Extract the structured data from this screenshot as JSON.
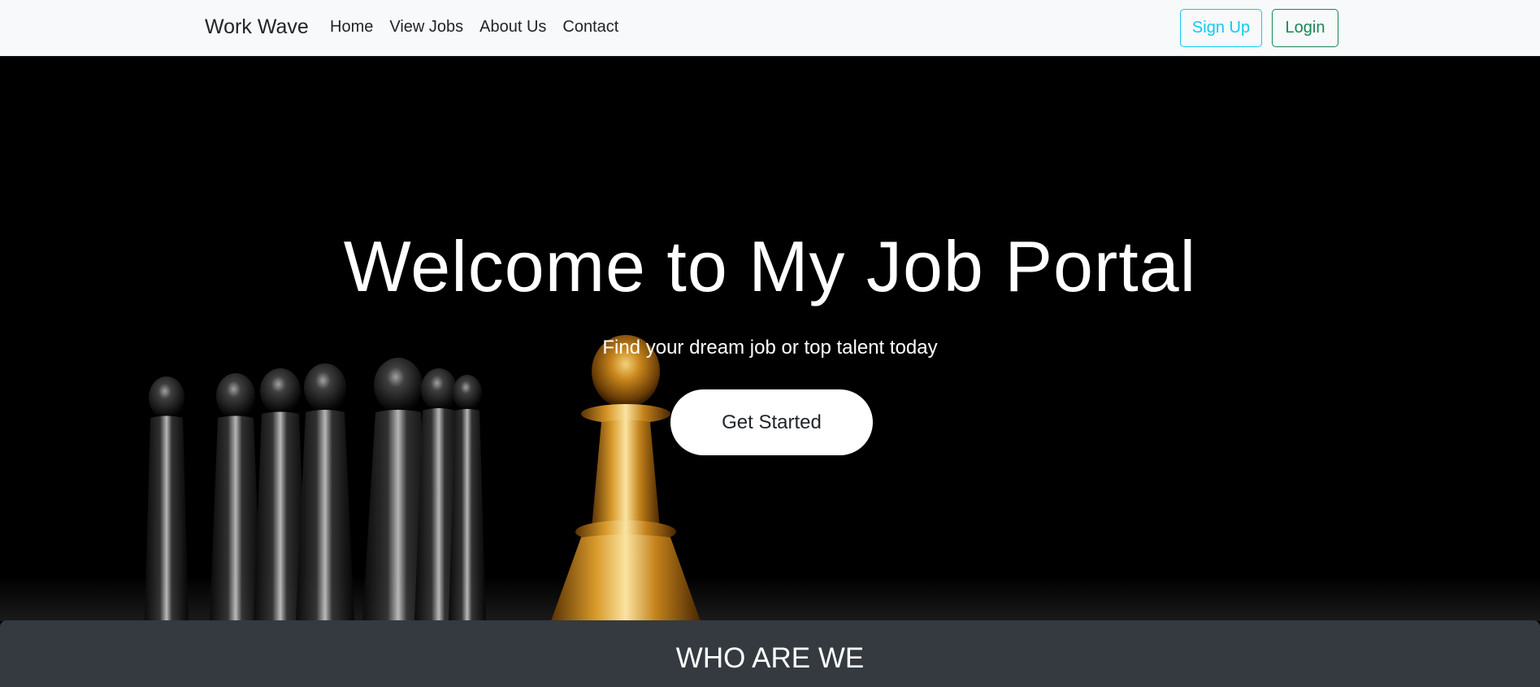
{
  "navbar": {
    "brand": "Work Wave",
    "links": [
      "Home",
      "View Jobs",
      "About Us",
      "Contact"
    ],
    "signup_label": "Sign Up",
    "login_label": "Login"
  },
  "hero": {
    "title": "Welcome to My Job Portal",
    "subtitle": "Find your dream job or top talent today",
    "cta_label": "Get Started",
    "background": "chess-pawns-image"
  },
  "about": {
    "title": "WHO ARE WE"
  },
  "colors": {
    "navbar_bg": "#f8f9fa",
    "signup": "#0dcaf0",
    "login": "#198754",
    "hero_bg": "#000000",
    "gold_pawn": "#c98a1e",
    "about_bg": "#343a40"
  }
}
